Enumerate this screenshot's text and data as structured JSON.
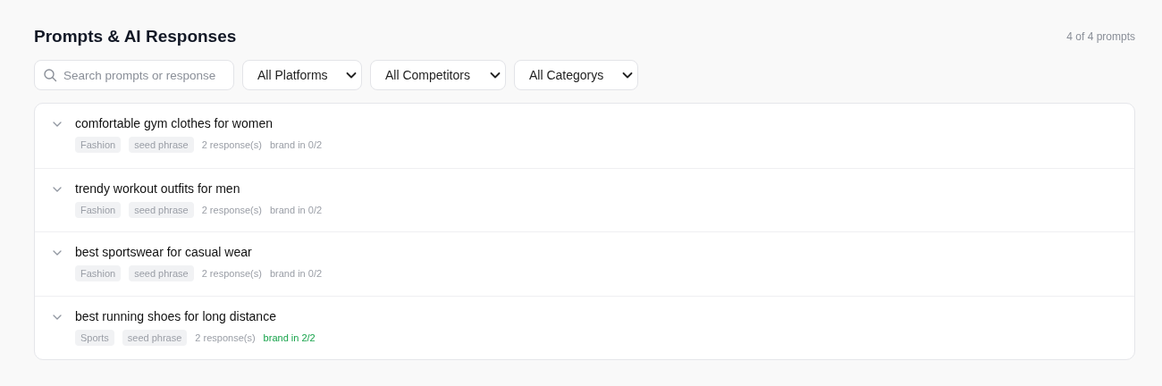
{
  "header": {
    "title": "Prompts & AI Responses",
    "count": "4 of 4 prompts"
  },
  "filters": {
    "search": {
      "placeholder": "Search prompts or response"
    },
    "dropdowns": [
      {
        "label": "All Platforms"
      },
      {
        "label": "All Competitors"
      },
      {
        "label": "All Categorys"
      }
    ]
  },
  "prompts": [
    {
      "text": "comfortable gym clothes for women",
      "expanded": false,
      "category": "Fashion",
      "source": "seed phrase",
      "responses": "2 response(s)",
      "brand": "brand in 0/2",
      "brand_mentioned": false
    },
    {
      "text": "trendy workout outfits for men",
      "expanded": false,
      "category": "Fashion",
      "source": "seed phrase",
      "responses": "2 response(s)",
      "brand": "brand in 0/2",
      "brand_mentioned": false
    },
    {
      "text": "best sportswear for casual wear",
      "expanded": false,
      "category": "Fashion",
      "source": "seed phrase",
      "responses": "2 response(s)",
      "brand": "brand in 0/2",
      "brand_mentioned": false
    },
    {
      "text": "best running shoes for long distance",
      "expanded": false,
      "category": "Sports",
      "source": "seed phrase",
      "responses": "2 response(s)",
      "brand": "brand in 2/2",
      "brand_mentioned": true
    }
  ]
}
